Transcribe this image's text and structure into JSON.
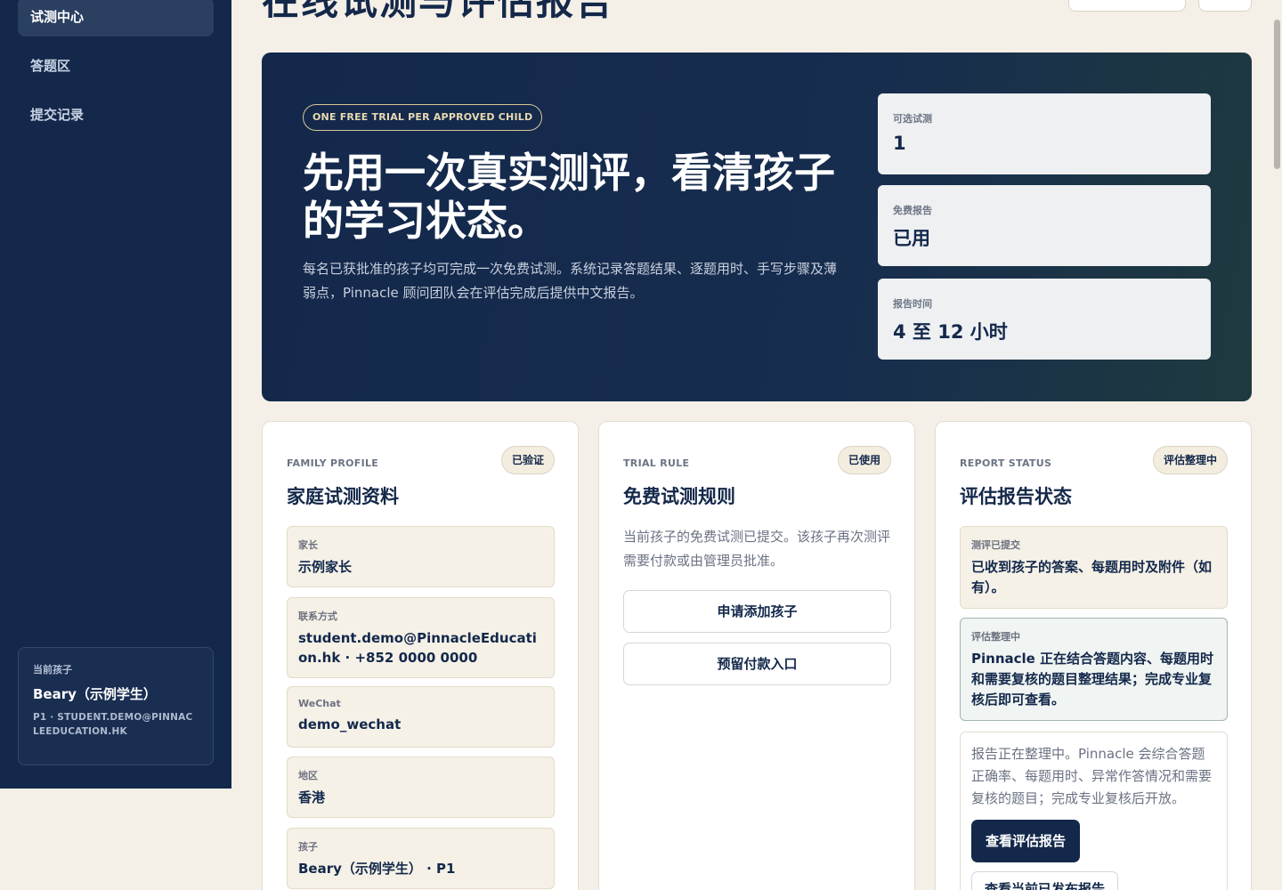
{
  "sidebar": {
    "items": [
      {
        "label": "试测中心",
        "active": true
      },
      {
        "label": "答题区",
        "active": false
      },
      {
        "label": "提交记录",
        "active": false
      }
    ],
    "current_child": {
      "label": "当前孩子",
      "name": "Beary（示例学生）",
      "meta": "P1 · STUDENT.DEMO@PINNACLEEDUCATION.HK"
    }
  },
  "header": {
    "title": "在线试测与评估报告"
  },
  "hero": {
    "badge": "ONE FREE TRIAL PER APPROVED CHILD",
    "title": "先用一次真实测评，看清孩子的学习状态。",
    "description": "每名已获批准的孩子均可完成一次免费试测。系统记录答题结果、逐题用时、手写步骤及薄弱点，Pinnacle 顾问团队会在评估完成后提供中文报告。",
    "stats": [
      {
        "label": "可选试测",
        "value": "1"
      },
      {
        "label": "免费报告",
        "value": "已用"
      },
      {
        "label": "报告时间",
        "value": "4 至 12 小时"
      }
    ]
  },
  "family_card": {
    "eyebrow": "FAMILY PROFILE",
    "pill": "已验证",
    "title": "家庭试测资料",
    "fields": [
      {
        "label": "家长",
        "value": "示例家长"
      },
      {
        "label": "联系方式",
        "value": "student.demo@PinnacleEducation.hk · +852 0000 0000"
      },
      {
        "label": "WeChat",
        "value": "demo_wechat"
      },
      {
        "label": "地区",
        "value": "香港"
      },
      {
        "label": "孩子",
        "value": "Beary（示例学生） · P1"
      }
    ]
  },
  "rule_card": {
    "eyebrow": "TRIAL RULE",
    "pill": "已使用",
    "title": "免费试测规则",
    "text": "当前孩子的免费试测已提交。该孩子再次测评需要付款或由管理员批准。",
    "buttons": [
      "申请添加孩子",
      "预留付款入口"
    ]
  },
  "report_card": {
    "eyebrow": "REPORT STATUS",
    "pill": "评估整理中",
    "title": "评估报告状态",
    "submitted": {
      "label": "测评已提交",
      "text": "已收到孩子的答案、每题用时及附件（如有）。"
    },
    "processing": {
      "label": "评估整理中",
      "text": "Pinnacle 正在结合答题内容、每题用时和需要复核的题目整理结果；完成专业复核后即可查看。"
    },
    "notice": "报告正在整理中。Pinnacle 会综合答题正确率、每题用时、异常作答情况和需要复核的题目；完成专业复核后开放。",
    "primary_button": "查看评估报告",
    "secondary_button": "查看当前已发布报告"
  }
}
